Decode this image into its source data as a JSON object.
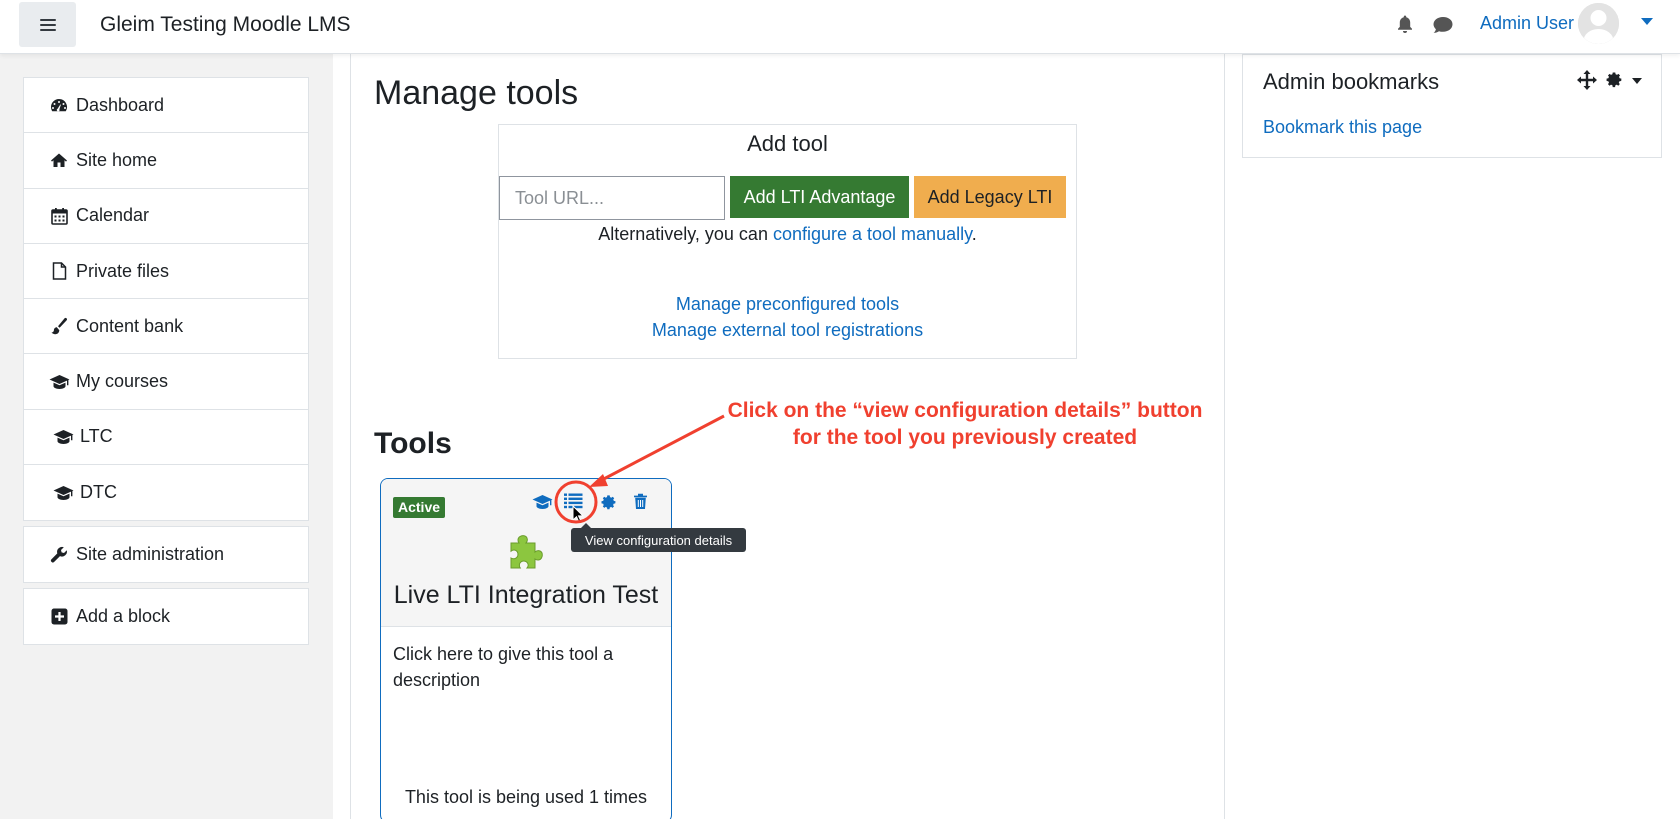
{
  "navbar": {
    "site_name": "Gleim Testing Moodle LMS",
    "user_name": "Admin User",
    "icons": [
      "hamburger-icon",
      "bell-icon",
      "chat-icon",
      "avatar",
      "chevron-down-icon"
    ]
  },
  "sidebar": {
    "items": [
      {
        "label": "Dashboard",
        "icon": "dashboard-icon"
      },
      {
        "label": "Site home",
        "icon": "home-icon"
      },
      {
        "label": "Calendar",
        "icon": "calendar-icon"
      },
      {
        "label": "Private files",
        "icon": "file-icon"
      },
      {
        "label": "Content bank",
        "icon": "paintbrush-icon"
      },
      {
        "label": "My courses",
        "icon": "graduation-cap-icon"
      },
      {
        "label": "LTC",
        "icon": "graduation-cap-icon"
      },
      {
        "label": "DTC",
        "icon": "graduation-cap-icon"
      }
    ],
    "site_admin": "Site administration",
    "add_block": "Add a block"
  },
  "main": {
    "title": "Manage tools",
    "add_tool": {
      "title": "Add tool",
      "url_placeholder": "Tool URL...",
      "url_value": "",
      "btn_advantage": "Add LTI Advantage",
      "btn_legacy": "Add Legacy LTI",
      "alt_prefix": "Alternatively, you can ",
      "alt_link": "configure a tool manually",
      "alt_suffix": ".",
      "link_preconfigured": "Manage preconfigured tools",
      "link_external": "Manage external tool registrations"
    },
    "tools_heading": "Tools",
    "tool_card": {
      "status": "Active",
      "name": "Live LTI Integration Test",
      "description": "Click here to give this tool a description",
      "usage": "This tool is being used 1 times",
      "tooltip": "View configuration details",
      "action_icons": [
        "graduation-cap-icon",
        "list-icon",
        "gear-icon",
        "trash-icon"
      ]
    },
    "annotation": {
      "line1": "Click on the “view configuration details” button",
      "line2": "for the tool you previously created",
      "color": "#f0402f"
    }
  },
  "right_block": {
    "title": "Admin bookmarks",
    "link": "Bookmark this page"
  },
  "colors": {
    "link": "#0f6cbf",
    "success": "#357a32",
    "warning": "#f0ad4e",
    "drawer_bg": "#f2f2f2"
  }
}
